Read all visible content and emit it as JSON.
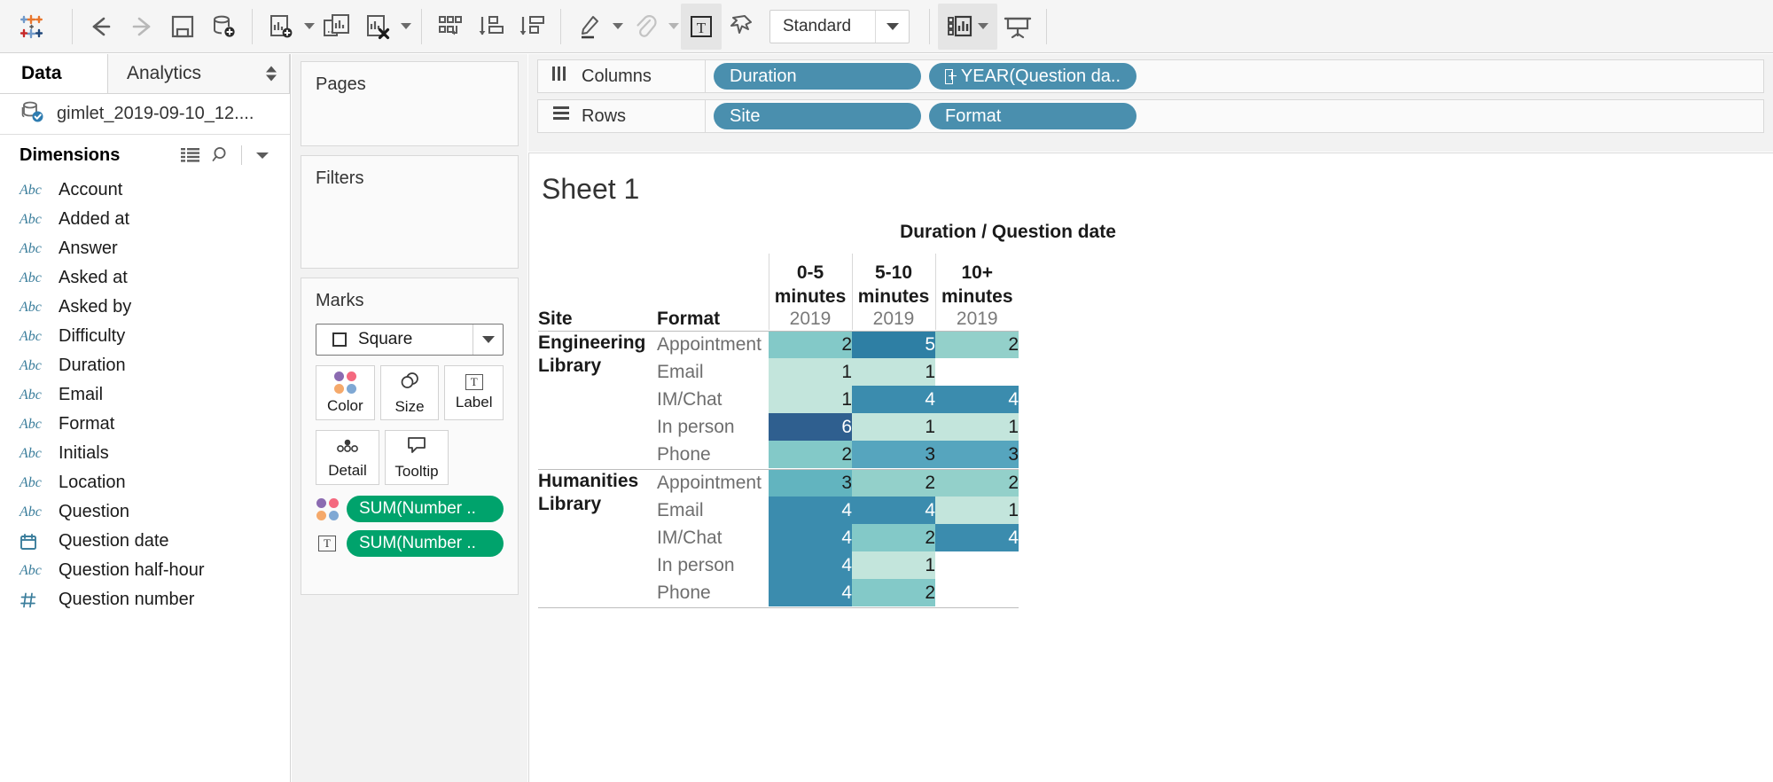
{
  "toolbar": {
    "logo": "tableau-logo",
    "buttons": [
      {
        "name": "back-button",
        "icon": "arrow-left-icon",
        "enabled": true
      },
      {
        "name": "forward-button",
        "icon": "arrow-right-icon",
        "enabled": false
      },
      {
        "name": "save-button",
        "icon": "save-icon",
        "enabled": true
      },
      {
        "name": "new-data-source-button",
        "icon": "database-plus-icon",
        "enabled": true
      },
      {
        "name": "new-worksheet-button",
        "icon": "new-sheet-icon",
        "enabled": true
      },
      {
        "name": "duplicate-sheet-button",
        "icon": "duplicate-sheet-icon",
        "enabled": true
      },
      {
        "name": "clear-sheet-button",
        "icon": "clear-sheet-icon",
        "enabled": true
      },
      {
        "name": "swap-rows-columns-button",
        "icon": "swap-icon",
        "enabled": true
      },
      {
        "name": "sort-ascending-button",
        "icon": "sort-asc-icon",
        "enabled": true
      },
      {
        "name": "sort-descending-button",
        "icon": "sort-desc-icon",
        "enabled": true
      },
      {
        "name": "highlight-button",
        "icon": "highlighter-icon",
        "enabled": true
      },
      {
        "name": "group-members-button",
        "icon": "paperclip-icon",
        "enabled": false
      },
      {
        "name": "show-mark-labels-button",
        "icon": "text-label-icon",
        "enabled": true,
        "active": true
      },
      {
        "name": "fix-axes-button",
        "icon": "pin-icon",
        "enabled": true
      },
      {
        "name": "show-me-button",
        "icon": "show-me-icon",
        "enabled": true
      },
      {
        "name": "presentation-mode-button",
        "icon": "presentation-icon",
        "enabled": true
      }
    ],
    "fit_select": {
      "value": "Standard",
      "name": "fit-dropdown"
    }
  },
  "datapane": {
    "tabs": {
      "data": "Data",
      "analytics": "Analytics"
    },
    "datasource": {
      "name": "gimlet_2019-09-10_12....",
      "icon": "database-connected-icon"
    },
    "dimensions_header": {
      "title": "Dimensions",
      "icons": [
        "list-view-icon",
        "search-icon",
        "chevron-down-icon"
      ]
    },
    "fields": [
      {
        "type": "Abc",
        "name": "Account"
      },
      {
        "type": "Abc",
        "name": "Added at"
      },
      {
        "type": "Abc",
        "name": "Answer"
      },
      {
        "type": "Abc",
        "name": "Asked at"
      },
      {
        "type": "Abc",
        "name": "Asked by"
      },
      {
        "type": "Abc",
        "name": "Difficulty"
      },
      {
        "type": "Abc",
        "name": "Duration"
      },
      {
        "type": "Abc",
        "name": "Email"
      },
      {
        "type": "Abc",
        "name": "Format"
      },
      {
        "type": "Abc",
        "name": "Initials"
      },
      {
        "type": "Abc",
        "name": "Location"
      },
      {
        "type": "Abc",
        "name": "Question"
      },
      {
        "type": "date",
        "name": "Question date"
      },
      {
        "type": "Abc",
        "name": "Question half-hour"
      },
      {
        "type": "num",
        "name": "Question number"
      }
    ]
  },
  "cards": {
    "pages": {
      "title": "Pages"
    },
    "filters": {
      "title": "Filters"
    },
    "marks": {
      "title": "Marks",
      "mark_type": "Square",
      "buttons": [
        {
          "label": "Color",
          "icon": "color-dots-icon"
        },
        {
          "label": "Size",
          "icon": "size-circles-icon"
        },
        {
          "label": "Label",
          "icon": "label-t-icon"
        },
        {
          "label": "Detail",
          "icon": "detail-dots-icon"
        },
        {
          "label": "Tooltip",
          "icon": "tooltip-bubble-icon"
        }
      ],
      "pills": [
        {
          "icon": "color-dots-icon",
          "label": "SUM(Number .."
        },
        {
          "icon": "label-t-icon",
          "label": "SUM(Number .."
        }
      ]
    }
  },
  "shelves": {
    "columns": {
      "label": "Columns",
      "icon": "columns-icon",
      "pills": [
        {
          "label": "Duration",
          "icon": null
        },
        {
          "label": "YEAR(Question da..",
          "icon": "plus-box-icon"
        }
      ]
    },
    "rows": {
      "label": "Rows",
      "icon": "rows-icon",
      "pills": [
        {
          "label": "Site",
          "icon": null
        },
        {
          "label": "Format",
          "icon": null
        }
      ]
    }
  },
  "viz": {
    "sheet_title": "Sheet 1"
  },
  "colors": {
    "pill_blue": "#4a8fae",
    "pill_green": "#00a36c",
    "heat_dark": "#2e6f96",
    "heat_mid": "#3c8dad",
    "heat_light": "#bfe3dc",
    "toolbar_bg": "#f5f5f5"
  },
  "chart_data": {
    "type": "heatmap",
    "title": "Duration / Question date",
    "xlabel": "Duration / Question date",
    "ylabel": "Site / Format",
    "row_headers": [
      "Site",
      "Format"
    ],
    "col_group_label": "Duration / Question date",
    "categories": [
      "0-5 minutes",
      "5-10 minutes",
      "10+ minutes"
    ],
    "sub_categories": [
      "2019",
      "2019",
      "2019"
    ],
    "legend": null,
    "grid": true,
    "color_scale": {
      "type": "sequential",
      "name": "Blue-Teal",
      "stops": [
        "#ffffff",
        "#c9e8e0",
        "#8ecfcb",
        "#63b6c4",
        "#3c8dad",
        "#2e6f96",
        "#2b5f8e"
      ],
      "domain": [
        0,
        6
      ]
    },
    "rows": [
      {
        "site": "Engineering Library",
        "format": "Appointment",
        "values": [
          2,
          5,
          2
        ],
        "cell_colors": [
          "#83c9c8",
          "#2e7fa4",
          "#93d0ca"
        ]
      },
      {
        "site": "Engineering Library",
        "format": "Email",
        "values": [
          1,
          1,
          null
        ],
        "cell_colors": [
          "#c3e5dc",
          "#c3e5dc",
          "#ffffff"
        ]
      },
      {
        "site": "Engineering Library",
        "format": "IM/Chat",
        "values": [
          1,
          4,
          4
        ],
        "cell_colors": [
          "#c3e5dc",
          "#3b8cae",
          "#3b8cae"
        ]
      },
      {
        "site": "Engineering Library",
        "format": "In person",
        "values": [
          6,
          1,
          1
        ],
        "cell_colors": [
          "#2f5f8f",
          "#c3e5dc",
          "#c3e5dc"
        ]
      },
      {
        "site": "Engineering Library",
        "format": "Phone",
        "values": [
          2,
          3,
          3
        ],
        "cell_colors": [
          "#83c9c8",
          "#56a5be",
          "#56a5be"
        ]
      },
      {
        "site": "Humanities Library",
        "format": "Appointment",
        "values": [
          3,
          2,
          2
        ],
        "cell_colors": [
          "#62b4bf",
          "#93d0ca",
          "#93d0ca"
        ]
      },
      {
        "site": "Humanities Library",
        "format": "Email",
        "values": [
          4,
          4,
          1
        ],
        "cell_colors": [
          "#3b8cae",
          "#3b8cae",
          "#c3e5dc"
        ]
      },
      {
        "site": "Humanities Library",
        "format": "IM/Chat",
        "values": [
          4,
          2,
          4
        ],
        "cell_colors": [
          "#3b8cae",
          "#83c9c8",
          "#3b8cae"
        ]
      },
      {
        "site": "Humanities Library",
        "format": "In person",
        "values": [
          4,
          1,
          null
        ],
        "cell_colors": [
          "#3b8cae",
          "#c3e5dc",
          "#ffffff"
        ]
      },
      {
        "site": "Humanities Library",
        "format": "Phone",
        "values": [
          4,
          2,
          null
        ],
        "cell_colors": [
          "#3b8cae",
          "#83c9c8",
          "#ffffff"
        ]
      }
    ]
  }
}
